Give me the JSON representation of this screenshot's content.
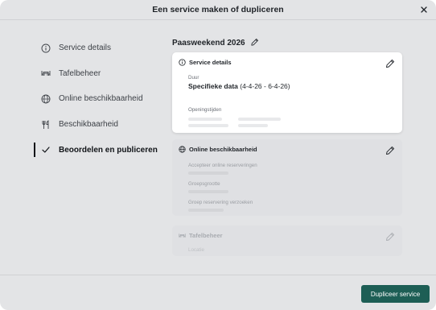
{
  "modal": {
    "title": "Een service maken of dupliceren",
    "close_icon": "close-icon"
  },
  "sidebar": {
    "items": [
      {
        "label": "Service details",
        "icon": "info-icon",
        "active": false
      },
      {
        "label": "Tafelbeheer",
        "icon": "table-icon",
        "active": false
      },
      {
        "label": "Online beschikbaarheid",
        "icon": "globe-icon",
        "active": false
      },
      {
        "label": "Beschikbaarheid",
        "icon": "cutlery-icon",
        "active": false
      },
      {
        "label": "Beoordelen en publiceren",
        "icon": "check-icon",
        "active": true
      }
    ]
  },
  "main": {
    "service_name": "Paasweekend 2026",
    "cards": [
      {
        "title": "Service details",
        "icon": "info-icon",
        "fields": [
          {
            "label": "Duur",
            "value_strong": "Specifieke data",
            "value_rest": " (4-4-26 - 6-4-26)"
          },
          {
            "label": "Openingstijden"
          }
        ]
      },
      {
        "title": "Online beschikbaarheid",
        "icon": "globe-icon",
        "fields": [
          {
            "label": "Accepteer online reserveringen"
          },
          {
            "label": "Groepsgrootte"
          },
          {
            "label": "Groep reservering verzoeken"
          }
        ]
      },
      {
        "title": "Tafelbeheer",
        "icon": "table-icon",
        "fields": [
          {
            "label": "Locatie"
          }
        ]
      }
    ]
  },
  "footer": {
    "primary_button": "Dupliceer service"
  },
  "colors": {
    "primary": "#1d5e55",
    "modal_bg": "#e3e4e6",
    "card_bg": "#ffffff"
  }
}
